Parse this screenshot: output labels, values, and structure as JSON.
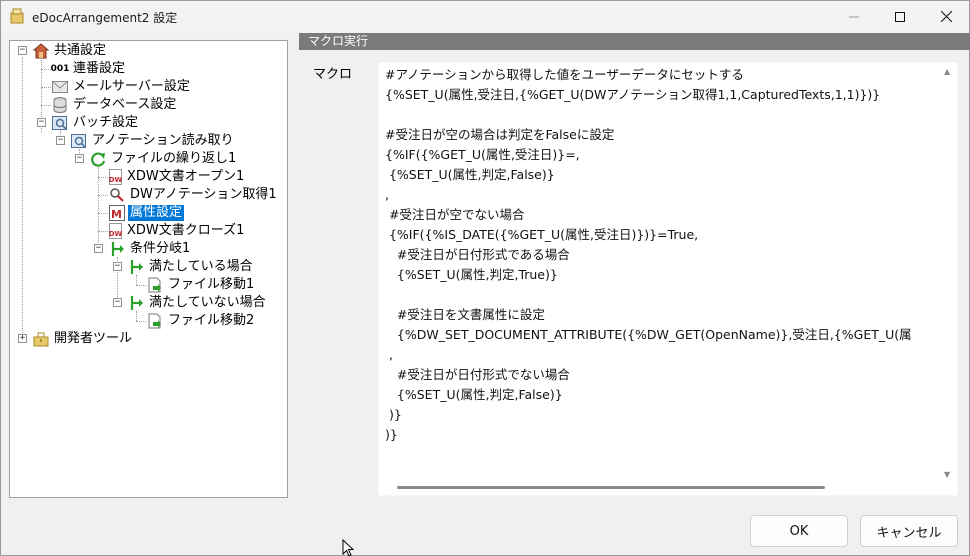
{
  "window": {
    "title": "eDocArrangement2 設定",
    "controls": [
      "minimize",
      "maximize",
      "close"
    ]
  },
  "tree": {
    "items": [
      {
        "label": "共通設定",
        "icon": "house-icon"
      },
      {
        "label": "連番設定",
        "icon": "sequence-001-icon",
        "icon_text": "001"
      },
      {
        "label": "メールサーバー設定",
        "icon": "mail-icon"
      },
      {
        "label": "データベース設定",
        "icon": "database-icon"
      },
      {
        "label": "バッチ設定",
        "icon": "batch-icon"
      },
      {
        "label": "アノテーション読み取り",
        "icon": "batch-icon"
      },
      {
        "label": "ファイルの繰り返し1",
        "icon": "loop-icon"
      },
      {
        "label": "XDW文書オープン1",
        "icon": "xdw-document-icon",
        "icon_text": "DW"
      },
      {
        "label": "DWアノテーション取得1",
        "icon": "annotation-search-icon"
      },
      {
        "label": "属性設定",
        "icon": "attribute-icon",
        "selected": true
      },
      {
        "label": "XDW文書クローズ1",
        "icon": "xdw-document-icon",
        "icon_text": "DW"
      },
      {
        "label": "条件分岐1",
        "icon": "branch-icon"
      },
      {
        "label": "満たしている場合",
        "icon": "branch-icon"
      },
      {
        "label": "ファイル移動1",
        "icon": "file-move-icon"
      },
      {
        "label": "満たしていない場合",
        "icon": "branch-icon"
      },
      {
        "label": "ファイル移動2",
        "icon": "file-move-icon"
      },
      {
        "label": "開発者ツール",
        "icon": "toolbox-icon"
      }
    ]
  },
  "panel": {
    "header": "マクロ実行",
    "macro_label": "マクロ",
    "macro_lines": [
      "#アノテーションから取得した値をユーザーデータにセットする",
      "{%SET_U(属性,受注日,{%GET_U(DWアノテーション取得1,1,CapturedTexts,1,1)})}",
      "",
      "#受注日が空の場合は判定をFalseに設定",
      "{%IF({%GET_U(属性,受注日)}=,",
      " {%SET_U(属性,判定,False)}",
      ",",
      " #受注日が空でない場合",
      " {%IF({%IS_DATE({%GET_U(属性,受注日)})}=True,",
      "   #受注日が日付形式である場合",
      "   {%SET_U(属性,判定,True)}",
      "",
      "   #受注日を文書属性に設定",
      "   {%DW_SET_DOCUMENT_ATTRIBUTE({%DW_GET(OpenName)},受注日,{%GET_U(属",
      " ,",
      "   #受注日が日付形式でない場合",
      "   {%SET_U(属性,判定,False)}",
      " )}",
      ")}"
    ]
  },
  "buttons": {
    "ok": "OK",
    "cancel": "キャンセル"
  },
  "colors": {
    "selection": "#0078d7",
    "section_header": "#7a7a7a",
    "window_bg": "#f0f0f0"
  }
}
